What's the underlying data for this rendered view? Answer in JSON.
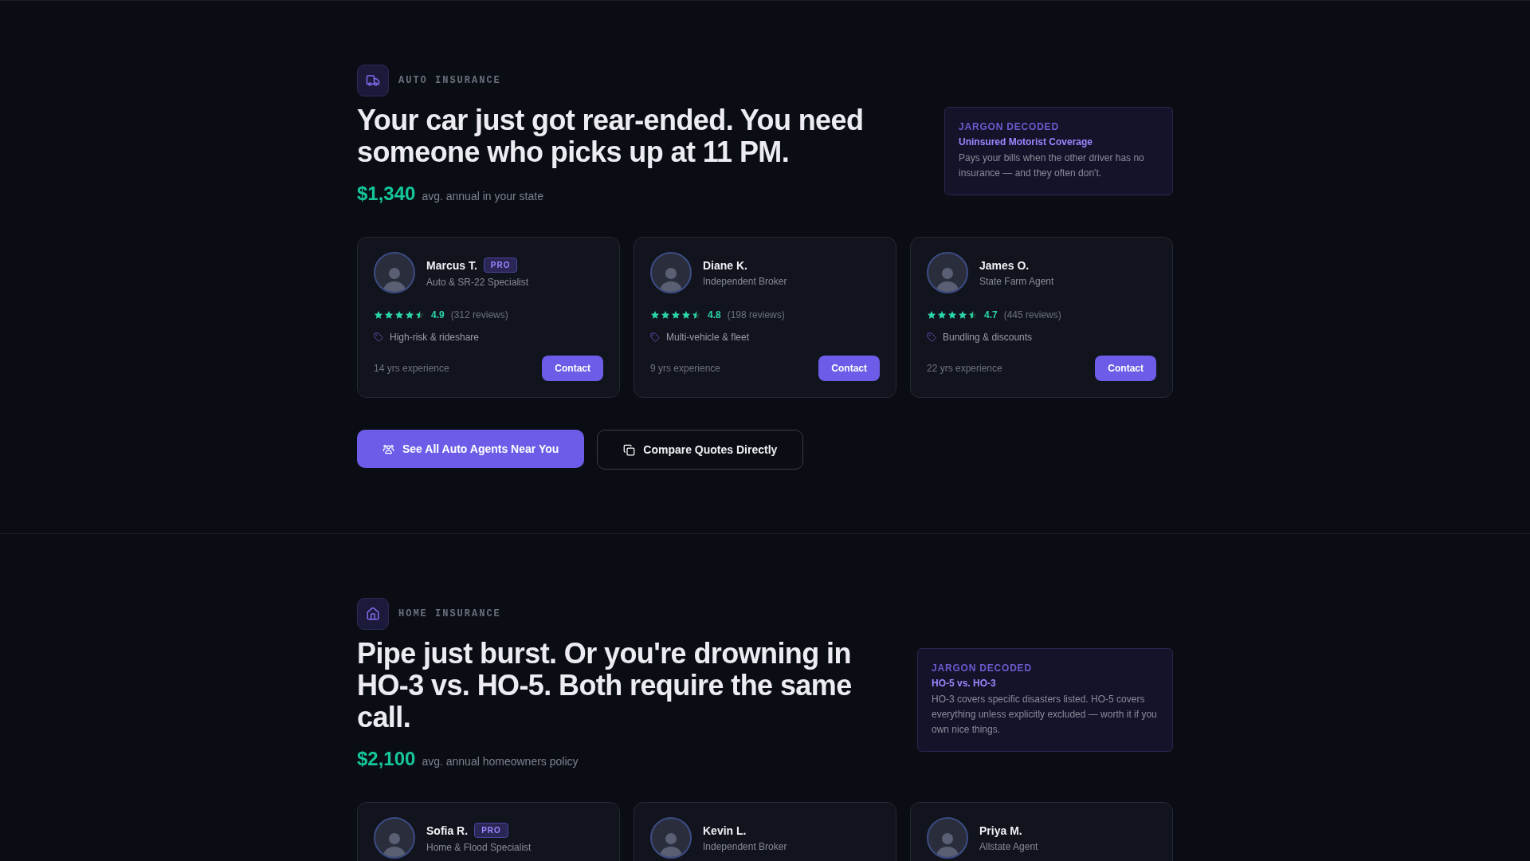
{
  "sections": [
    {
      "kind": "auto",
      "label": "AUTO INSURANCE",
      "headline": "Your car just got rear-ended. You need someone who picks up at 11 PM.",
      "price": "$1,340",
      "price_note": "avg. annual in your state",
      "jargon": {
        "heading": "JARGON DECODED",
        "term": "Uninsured Motorist Coverage",
        "definition": "Pays your bills when the other driver has no insurance — and they often don't."
      },
      "agents": [
        {
          "name": "Marcus T.",
          "pro": true,
          "badge": "PRO",
          "role": "Auto & SR-22 Specialist",
          "stars": 4.5,
          "rating": "4.9",
          "reviews": "(312 reviews)",
          "specialty": "High-risk & rideshare",
          "experience": "14 yrs experience",
          "action": "Contact"
        },
        {
          "name": "Diane K.",
          "pro": false,
          "role": "Independent Broker",
          "stars": 4.5,
          "rating": "4.8",
          "reviews": "(198 reviews)",
          "specialty": "Multi-vehicle & fleet",
          "experience": "9 yrs experience",
          "action": "Contact"
        },
        {
          "name": "James O.",
          "pro": false,
          "role": "State Farm Agent",
          "stars": 4.5,
          "rating": "4.7",
          "reviews": "(445 reviews)",
          "specialty": "Bundling & discounts",
          "experience": "22 yrs experience",
          "action": "Contact"
        }
      ],
      "primary_button": "See All Auto Agents Near You",
      "secondary_button": "Compare Quotes Directly"
    },
    {
      "kind": "home",
      "label": "HOME INSURANCE",
      "headline": "Pipe just burst. Or you're drowning in HO-3 vs. HO-5. Both require the same call.",
      "price": "$2,100",
      "price_note": "avg. annual homeowners policy",
      "jargon": {
        "heading": "JARGON DECODED",
        "term": "HO-5 vs. HO-3",
        "definition": "HO-3 covers specific disasters listed. HO-5 covers everything unless explicitly excluded — worth it if you own nice things."
      },
      "agents": [
        {
          "name": "Sofia R.",
          "pro": true,
          "badge": "PRO",
          "role": "Home & Flood Specialist"
        },
        {
          "name": "Kevin L.",
          "pro": false,
          "role": "Independent Broker"
        },
        {
          "name": "Priya M.",
          "pro": false,
          "role": "Allstate Agent"
        }
      ]
    }
  ]
}
